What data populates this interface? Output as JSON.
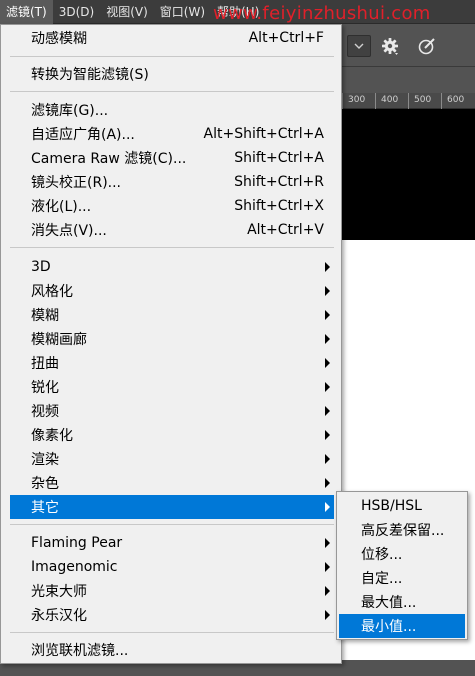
{
  "menubar": {
    "items": [
      {
        "label": "滤镜(T)",
        "active": true
      },
      {
        "label": "3D(D)",
        "active": false
      },
      {
        "label": "视图(V)",
        "active": false
      },
      {
        "label": "窗口(W)",
        "active": false
      },
      {
        "label": "帮助(H)",
        "active": false
      }
    ]
  },
  "watermark": "www.feiyinzhushui.com",
  "ruler": {
    "labels": [
      "300",
      "400",
      "500",
      "600"
    ]
  },
  "icons": {
    "gear": "gear-icon",
    "brush": "brush-settings-icon",
    "dropdown": "chevron-down-icon",
    "submenu": "chevron-right-icon"
  },
  "colors": {
    "highlight": "#0078d7",
    "menu_bg": "#f0f0f0",
    "watermark": "#e0202a"
  },
  "menu": {
    "groups": [
      [
        {
          "label": "动感模糊",
          "shortcut": "Alt+Ctrl+F"
        }
      ],
      [
        {
          "label": "转换为智能滤镜(S)",
          "shortcut": ""
        }
      ],
      [
        {
          "label": "滤镜库(G)...",
          "shortcut": ""
        },
        {
          "label": "自适应广角(A)...",
          "shortcut": "Alt+Shift+Ctrl+A"
        },
        {
          "label": "Camera Raw 滤镜(C)...",
          "shortcut": "Shift+Ctrl+A"
        },
        {
          "label": "镜头校正(R)...",
          "shortcut": "Shift+Ctrl+R"
        },
        {
          "label": "液化(L)...",
          "shortcut": "Shift+Ctrl+X"
        },
        {
          "label": "消失点(V)...",
          "shortcut": "Alt+Ctrl+V"
        }
      ],
      [
        {
          "label": "3D",
          "submenu": true
        },
        {
          "label": "风格化",
          "submenu": true
        },
        {
          "label": "模糊",
          "submenu": true
        },
        {
          "label": "模糊画廊",
          "submenu": true
        },
        {
          "label": "扭曲",
          "submenu": true
        },
        {
          "label": "锐化",
          "submenu": true
        },
        {
          "label": "视频",
          "submenu": true
        },
        {
          "label": "像素化",
          "submenu": true
        },
        {
          "label": "渲染",
          "submenu": true
        },
        {
          "label": "杂色",
          "submenu": true
        },
        {
          "label": "其它",
          "submenu": true,
          "highlighted": true
        }
      ],
      [
        {
          "label": "Flaming Pear",
          "submenu": true
        },
        {
          "label": "Imagenomic",
          "submenu": true
        },
        {
          "label": "光束大师",
          "submenu": true
        },
        {
          "label": "永乐汉化",
          "submenu": true
        }
      ],
      [
        {
          "label": "浏览联机滤镜...",
          "shortcut": ""
        }
      ]
    ]
  },
  "submenu": {
    "items": [
      {
        "label": "HSB/HSL",
        "highlighted": false
      },
      {
        "label": "高反差保留...",
        "highlighted": false
      },
      {
        "label": "位移...",
        "highlighted": false
      },
      {
        "label": "自定...",
        "highlighted": false
      },
      {
        "label": "最大值...",
        "highlighted": false
      },
      {
        "label": "最小值...",
        "highlighted": true
      }
    ]
  }
}
